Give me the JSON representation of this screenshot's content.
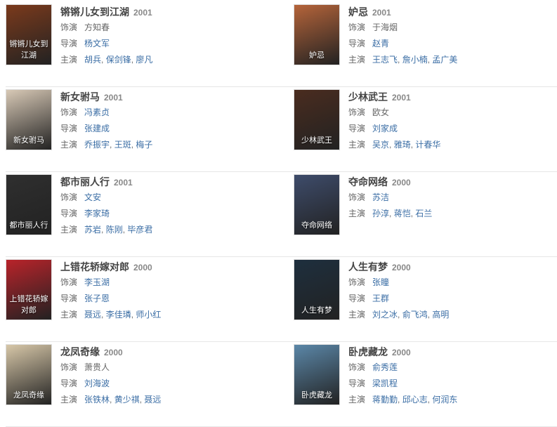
{
  "items": [
    {
      "title": "锵锵儿女到江湖",
      "year": "2001",
      "roles": [
        {
          "label": "饰演",
          "text": "方知春",
          "linked": false
        },
        {
          "label": "导演",
          "names": [
            "杨文军"
          ]
        },
        {
          "label": "主演",
          "names": [
            "胡兵",
            "保剑锋",
            "廖凡"
          ]
        }
      ],
      "poster_color": "#7b3a1c",
      "poster_text": "锵锵儿女到江湖"
    },
    {
      "title": "妒忌",
      "year": "2001",
      "roles": [
        {
          "label": "饰演",
          "text": "于海烟",
          "linked": false
        },
        {
          "label": "导演",
          "names": [
            "赵青"
          ]
        },
        {
          "label": "主演",
          "names": [
            "王志飞",
            "詹小楠",
            "孟广美"
          ]
        }
      ],
      "poster_color": "#b5643a",
      "poster_text": "妒忌"
    },
    {
      "title": "新女驸马",
      "year": "2001",
      "roles": [
        {
          "label": "饰演",
          "text": "冯素贞",
          "linked": true
        },
        {
          "label": "导演",
          "names": [
            "张建成"
          ]
        },
        {
          "label": "主演",
          "names": [
            "乔振宇",
            "王斑",
            "梅子"
          ]
        }
      ],
      "poster_color": "#d8c9b6",
      "poster_text": "新女驸马"
    },
    {
      "title": "少林武王",
      "year": "2001",
      "roles": [
        {
          "label": "饰演",
          "text": "欧女",
          "linked": false
        },
        {
          "label": "导演",
          "names": [
            "刘家成"
          ]
        },
        {
          "label": "主演",
          "names": [
            "吴京",
            "雅琦",
            "计春华"
          ]
        }
      ],
      "poster_color": "#4a2c1f",
      "poster_text": "少林武王"
    },
    {
      "title": "都市丽人行",
      "year": "2001",
      "roles": [
        {
          "label": "饰演",
          "text": "文安",
          "linked": true
        },
        {
          "label": "导演",
          "names": [
            "李家琦"
          ]
        },
        {
          "label": "主演",
          "names": [
            "苏岩",
            "陈刚",
            "毕彦君"
          ]
        }
      ],
      "poster_color": "#2f2f2f",
      "poster_text": "都市丽人行"
    },
    {
      "title": "夺命网络",
      "year": "2000",
      "roles": [
        {
          "label": "饰演",
          "text": "苏洁",
          "linked": true
        },
        {
          "label": "主演",
          "names": [
            "孙淳",
            "蒋恺",
            "石兰"
          ]
        }
      ],
      "poster_color": "#3e4c6b",
      "poster_text": "夺命网络"
    },
    {
      "title": "上错花轿嫁对郎",
      "year": "2000",
      "roles": [
        {
          "label": "饰演",
          "text": "李玉湖",
          "linked": true
        },
        {
          "label": "导演",
          "names": [
            "张子恩"
          ]
        },
        {
          "label": "主演",
          "names": [
            "聂远",
            "李佳璘",
            "师小红"
          ]
        }
      ],
      "poster_color": "#b9232a",
      "poster_text": "上错花轿嫁对郎"
    },
    {
      "title": "人生有梦",
      "year": "2000",
      "roles": [
        {
          "label": "饰演",
          "text": "张瞳",
          "linked": true
        },
        {
          "label": "导演",
          "names": [
            "王群"
          ]
        },
        {
          "label": "主演",
          "names": [
            "刘之冰",
            "俞飞鸿",
            "高明"
          ]
        }
      ],
      "poster_color": "#1e2f3e",
      "poster_text": "人生有梦"
    },
    {
      "title": "龙凤奇缘",
      "year": "2000",
      "roles": [
        {
          "label": "饰演",
          "text": "萧贵人",
          "linked": false
        },
        {
          "label": "导演",
          "names": [
            "刘海波"
          ]
        },
        {
          "label": "主演",
          "names": [
            "张铁林",
            "黄少祺",
            "聂远"
          ]
        }
      ],
      "poster_color": "#d7c7a8",
      "poster_text": "龙凤奇缘"
    },
    {
      "title": "卧虎藏龙",
      "year": "2000",
      "roles": [
        {
          "label": "饰演",
          "text": "俞秀莲",
          "linked": true
        },
        {
          "label": "导演",
          "names": [
            "梁凯程"
          ]
        },
        {
          "label": "主演",
          "names": [
            "蒋勤勤",
            "邱心志",
            "何润东"
          ]
        }
      ],
      "poster_color": "#5b87a8",
      "poster_text": "卧虎藏龙"
    }
  ]
}
